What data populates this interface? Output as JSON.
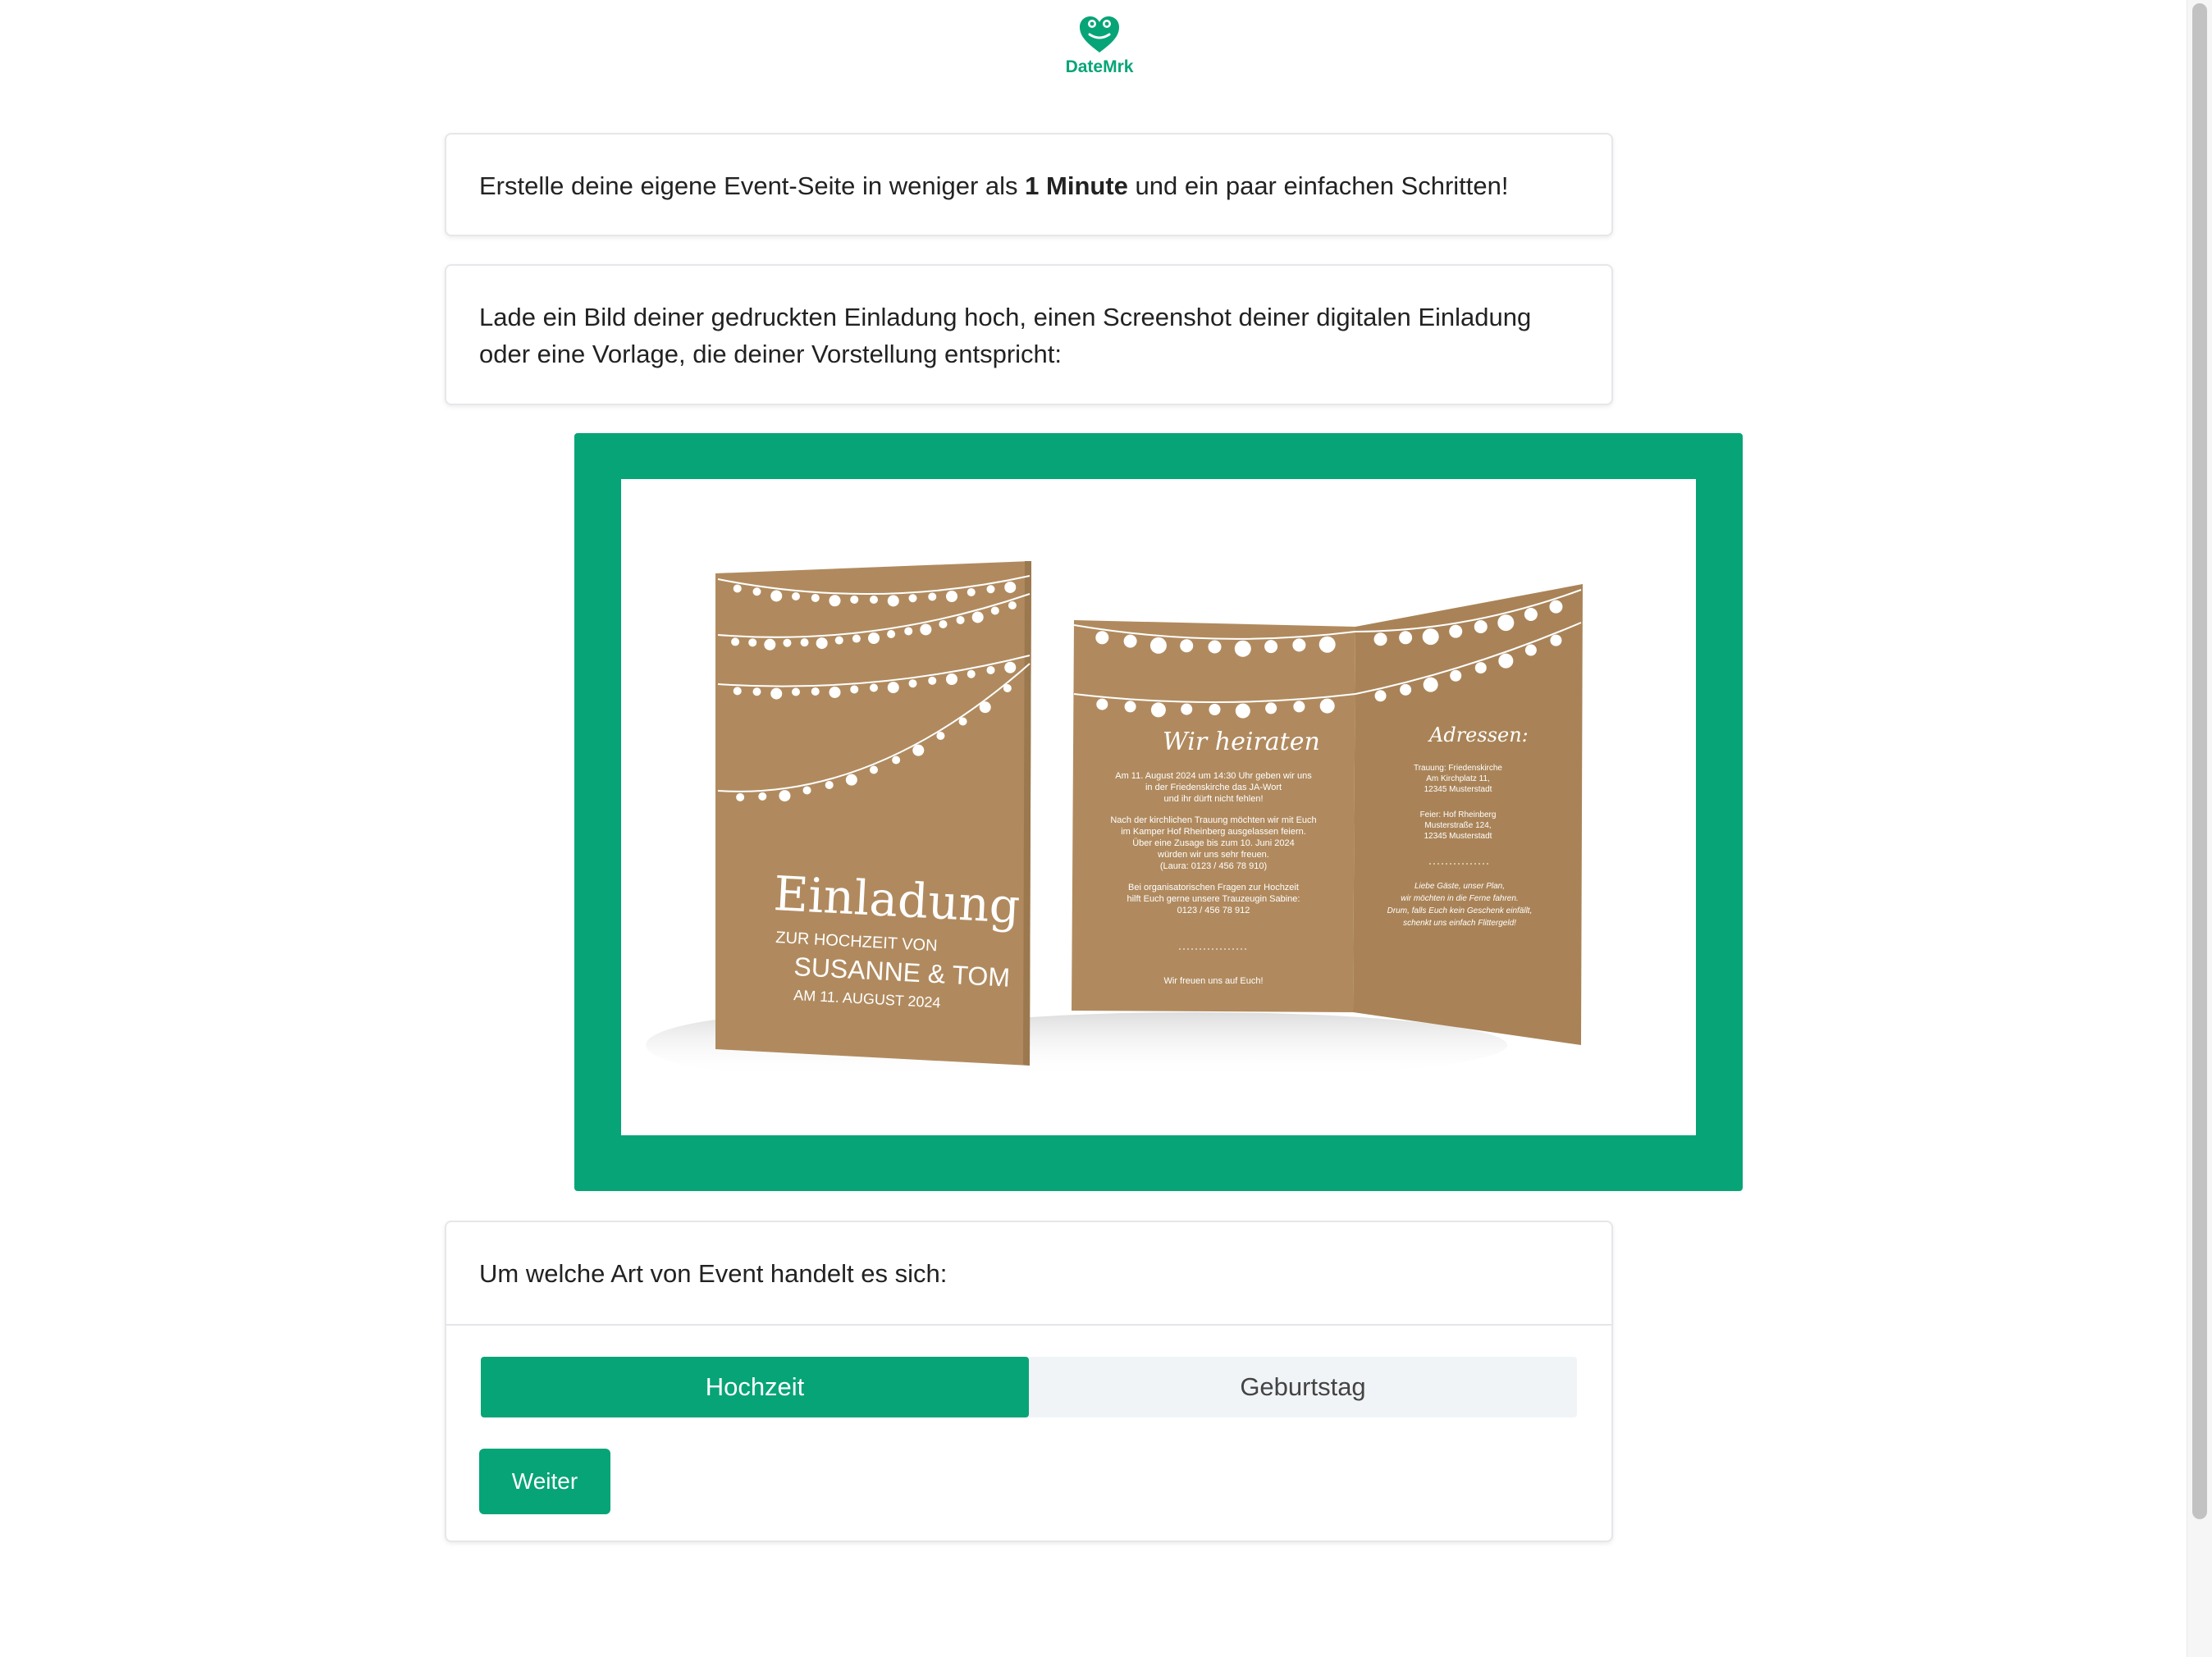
{
  "brand": {
    "name": "DateMrk",
    "color": "#07a477",
    "icon": "heart-frog-icon"
  },
  "intro": {
    "before": "Erstelle deine eigene Event-Seite in weniger als ",
    "bold": "1 Minute",
    "after": " und ein paar einfachen Schritten!"
  },
  "upload_prompt": "Lade ein Bild deiner gedruckten Einladung hoch, einen Screenshot deiner digitalen Einladung oder eine Vorlage, die deiner Vorstellung entspricht:",
  "invitation": {
    "front_title": "Einladung",
    "front_subtitle": "ZUR HOCHZEIT VON",
    "front_names": "SUSANNE & TOM",
    "front_date": "AM 11. AUGUST 2024",
    "inside_heading": "Wir heiraten",
    "inside_paragraph1": [
      "Am 11. August 2024 um 14:30 Uhr geben wir uns",
      "in der Friedenskirche das JA-Wort",
      "und ihr dürft nicht fehlen!"
    ],
    "inside_paragraph2": [
      "Nach der kirchlichen Trauung möchten wir mit Euch",
      "im Kamper Hof Rheinberg ausgelassen feiern.",
      "Über eine Zusage bis zum 10. Juni 2024",
      "würden wir uns sehr freuen.",
      "(Laura: 0123 / 456 78 910)"
    ],
    "inside_paragraph3": [
      "Bei organisatorischen Fragen zur Hochzeit",
      "hilft Euch gerne unsere Trauzeugin Sabine:",
      "0123 / 456 78 912"
    ],
    "inside_closing": "Wir freuen uns auf Euch!",
    "addresses_heading": "Adressen:",
    "address1": [
      "Trauung: Friedenskirche",
      "Am Kirchplatz 11,",
      "12345 Musterstadt"
    ],
    "address2": [
      "Feier: Hof Rheinberg",
      "Musterstraße 124,",
      "12345 Musterstadt"
    ],
    "guest_note": [
      "Liebe Gäste, unser Plan,",
      "wir möchten in die Ferne fahren.",
      "Drum, falls Euch kein Geschenk einfällt,",
      "schenkt uns einfach Flittergeld!"
    ],
    "kraft_color": "#b08a5e"
  },
  "event_type": {
    "question": "Um welche Art von Event handelt es sich:",
    "options": [
      "Hochzeit",
      "Geburtstag"
    ],
    "selected": "Hochzeit"
  },
  "next_button": "Weiter"
}
